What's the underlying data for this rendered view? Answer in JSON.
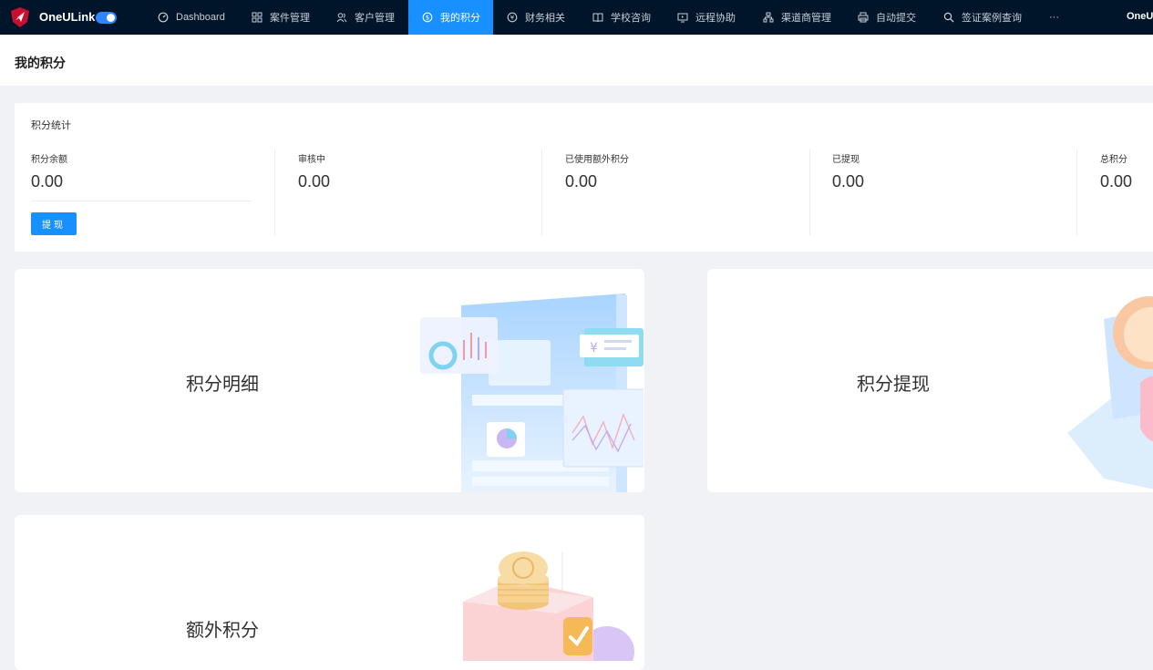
{
  "brand": "OneULink",
  "nav": {
    "items": [
      {
        "label": "Dashboard",
        "icon": "dashboard-icon"
      },
      {
        "label": "案件管理",
        "icon": "grid-icon"
      },
      {
        "label": "客户管理",
        "icon": "users-icon"
      },
      {
        "label": "我的积分",
        "icon": "coin-icon",
        "active": true
      },
      {
        "label": "财务相关",
        "icon": "money-icon"
      },
      {
        "label": "学校咨询",
        "icon": "book-icon"
      },
      {
        "label": "远程协助",
        "icon": "screen-icon"
      },
      {
        "label": "渠道商管理",
        "icon": "org-icon"
      },
      {
        "label": "自动提交",
        "icon": "printer-icon"
      },
      {
        "label": "签证案例查询",
        "icon": "search-icon"
      }
    ],
    "more": "···",
    "right_label": "OneU"
  },
  "page": {
    "title": "我的积分"
  },
  "stats": {
    "title": "积分统计",
    "items": [
      {
        "label": "积分余额",
        "value": "0.00"
      },
      {
        "label": "审核中",
        "value": "0.00"
      },
      {
        "label": "已使用额外积分",
        "value": "0.00"
      },
      {
        "label": "已提现",
        "value": "0.00"
      },
      {
        "label": "总积分",
        "value": "0.00"
      }
    ],
    "withdraw_button": "提现"
  },
  "tiles": [
    {
      "title": "积分明细"
    },
    {
      "title": "积分提现"
    },
    {
      "title": "额外积分"
    }
  ],
  "colors": {
    "nav_bg": "#001529",
    "accent": "#1890ff",
    "page_bg": "#f0f2f5"
  }
}
